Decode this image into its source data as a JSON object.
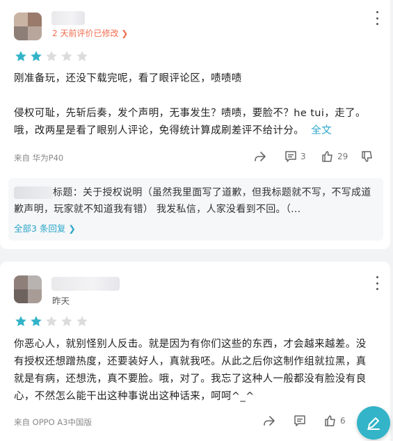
{
  "colors": {
    "accent": "#2aa6c9",
    "star_on": "#33b4c8",
    "star_off": "#dcdcdc",
    "edited": "#f26c4f"
  },
  "reviews": [
    {
      "meta": "2 天前评价已修改 ❯",
      "rating": 2,
      "rating_max": 5,
      "body_line1": "刚准备玩，还没下载完呢，看了眼评论区，啧啧啧",
      "body_line2": "侵权可耻，先斩后奏，发个声明，无事发生？啧啧，要脸不？he tui，走了。哦，改两星是看了眼别人评论，免得统计算成刷差评不给计分。",
      "full_text_label": "全文",
      "device": "来自 华为P40",
      "share_icon": "share-icon",
      "reply_count": "3",
      "like_count": "29",
      "dislike_count": "",
      "reply_preview": "标题：关于授权说明（虽然我里面写了道歉，但我标题就不写，不写成道歉声明，玩家就不知道我有错） 我发私信，人家没看到不回。（...",
      "replies_label": "全部3 条回复 ❯"
    },
    {
      "meta": "昨天",
      "rating": 2,
      "rating_max": 5,
      "body": "你恶心人，就别怪别人反击。就是因为有你们这些的东西，才会越来越差。没有授权还想蹭热度，还要装好人，真就我呸。从此之后你这制作组就拉黑，真就是有病，还想洗，真不要脸。哦，对了。我忘了这种人一般都没有脸没有良心，不然怎么能干出这种事说出这种话来，呵呵^_^",
      "device": "来自 OPPO A3中国版",
      "reply_count": "",
      "like_count": "6"
    }
  ],
  "fab_icon": "edit-icon"
}
